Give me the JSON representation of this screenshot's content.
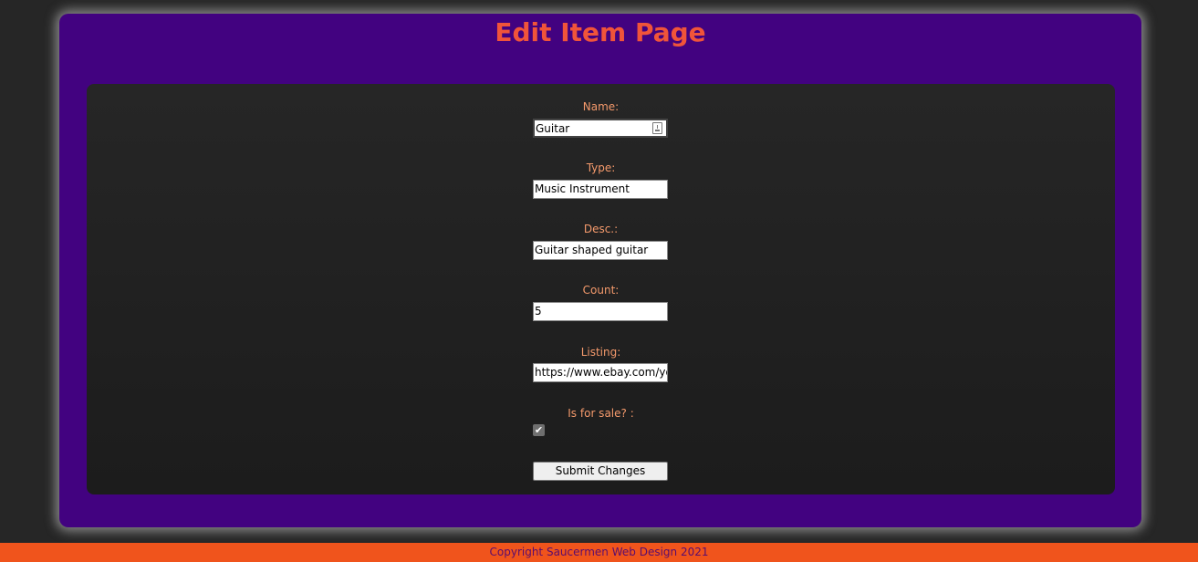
{
  "page": {
    "title": "Edit Item Page"
  },
  "form": {
    "name": {
      "label": "Name:",
      "value": "Guitar"
    },
    "type": {
      "label": "Type:",
      "value": "Music Instrument"
    },
    "desc": {
      "label": "Desc.:",
      "value": "Guitar shaped guitar"
    },
    "count": {
      "label": "Count:",
      "value": "5"
    },
    "listing": {
      "label": "Listing:",
      "value": "https://www.ebay.com/your"
    },
    "for_sale": {
      "label": "Is for sale? :",
      "checked": true,
      "check_glyph": "✔"
    },
    "submit_label": "Submit Changes"
  },
  "footer": {
    "text": "Copyright Saucermen Web Design 2021"
  },
  "colors": {
    "background": "#262626",
    "panel": "#420280",
    "title": "#f0543a",
    "label": "#f59a6c",
    "footer_bg": "#f0541c",
    "footer_text": "#5a0d6e"
  }
}
